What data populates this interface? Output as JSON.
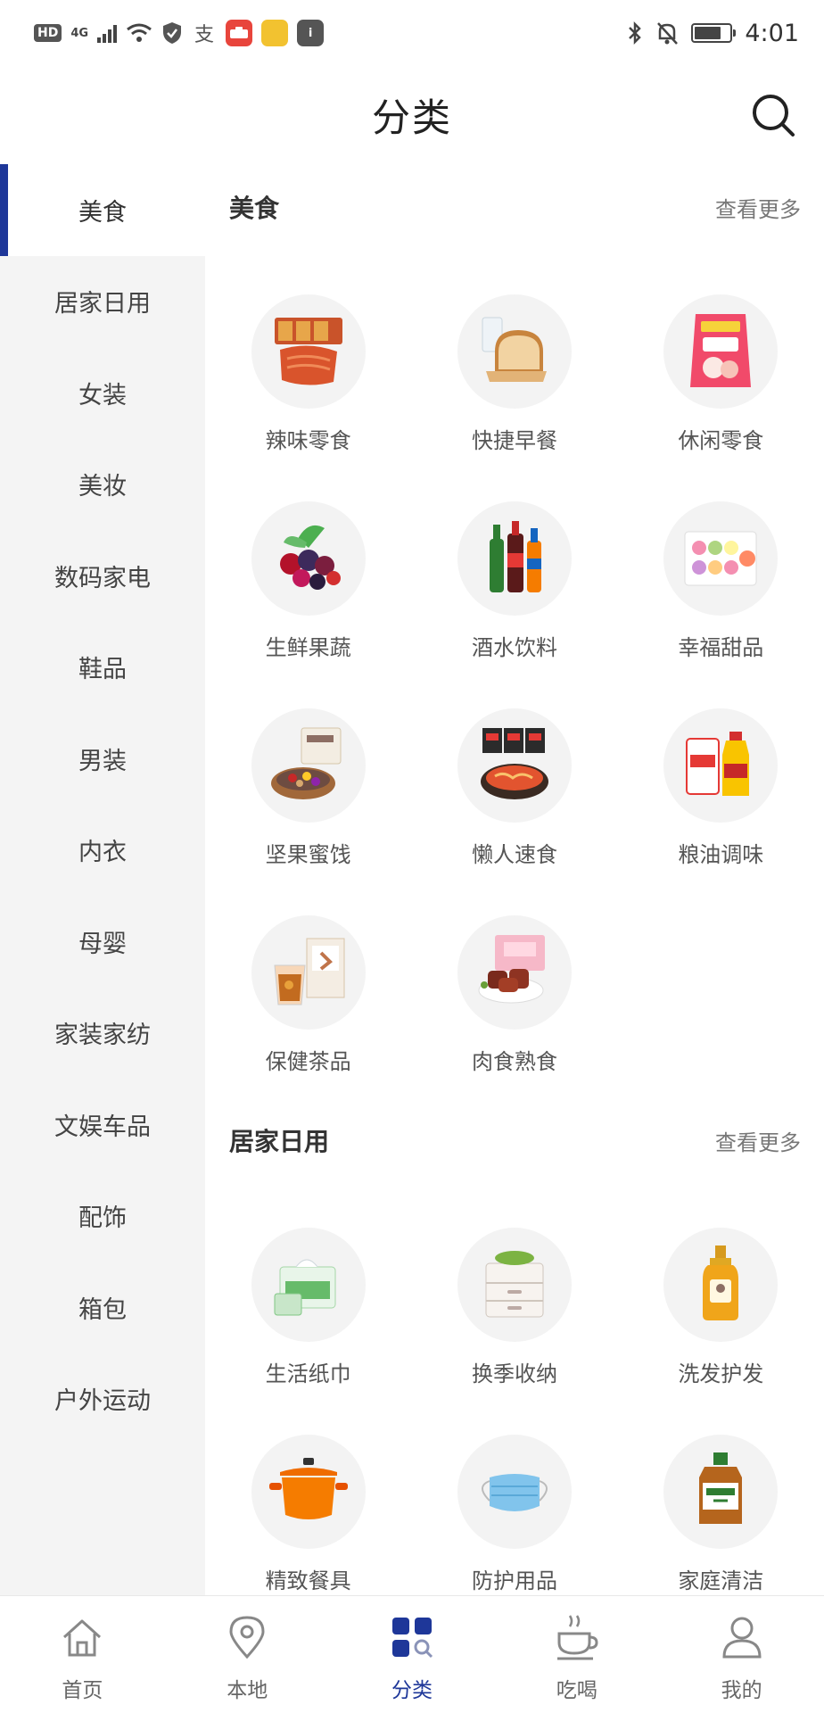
{
  "status_bar": {
    "hd": "HD",
    "network": "4G",
    "app_badge": "HUAWEI",
    "time": "4:01",
    "battery_level": 0.75
  },
  "header": {
    "title": "分类"
  },
  "sidebar": {
    "active_index": 0,
    "items": [
      {
        "label": "美食"
      },
      {
        "label": "居家日用"
      },
      {
        "label": "女装"
      },
      {
        "label": "美妆"
      },
      {
        "label": "数码家电"
      },
      {
        "label": "鞋品"
      },
      {
        "label": "男装"
      },
      {
        "label": "内衣"
      },
      {
        "label": "母婴"
      },
      {
        "label": "家装家纺"
      },
      {
        "label": "文娱车品"
      },
      {
        "label": "配饰"
      },
      {
        "label": "箱包"
      },
      {
        "label": "户外运动"
      }
    ]
  },
  "sections": [
    {
      "title": "美食",
      "more": "查看更多",
      "items": [
        {
          "label": "辣味零食",
          "icon": "spicy-snack-icon"
        },
        {
          "label": "快捷早餐",
          "icon": "bread-icon"
        },
        {
          "label": "休闲零食",
          "icon": "snack-bag-icon"
        },
        {
          "label": "生鲜果蔬",
          "icon": "berries-icon"
        },
        {
          "label": "酒水饮料",
          "icon": "bottles-icon"
        },
        {
          "label": "幸福甜品",
          "icon": "macaron-icon"
        },
        {
          "label": "坚果蜜饯",
          "icon": "nuts-icon"
        },
        {
          "label": "懒人速食",
          "icon": "instant-noodle-icon"
        },
        {
          "label": "粮油调味",
          "icon": "oil-rice-icon"
        },
        {
          "label": "保健茶品",
          "icon": "tea-icon"
        },
        {
          "label": "肉食熟食",
          "icon": "meat-icon"
        }
      ]
    },
    {
      "title": "居家日用",
      "more": "查看更多",
      "items": [
        {
          "label": "生活纸巾",
          "icon": "tissue-icon"
        },
        {
          "label": "换季收纳",
          "icon": "storage-box-icon"
        },
        {
          "label": "洗发护发",
          "icon": "shampoo-icon"
        },
        {
          "label": "精致餐具",
          "icon": "pot-icon"
        },
        {
          "label": "防护用品",
          "icon": "mask-icon"
        },
        {
          "label": "家庭清洁",
          "icon": "disinfectant-icon"
        }
      ]
    }
  ],
  "bottom_nav": {
    "active_index": 2,
    "items": [
      {
        "label": "首页",
        "icon": "home-icon"
      },
      {
        "label": "本地",
        "icon": "location-icon"
      },
      {
        "label": "分类",
        "icon": "category-icon"
      },
      {
        "label": "吃喝",
        "icon": "coffee-cup-icon"
      },
      {
        "label": "我的",
        "icon": "profile-icon"
      }
    ]
  },
  "colors": {
    "accent": "#1e3799",
    "sidebar_bg": "#f4f4f4",
    "thumb_bg": "#f3f3f3"
  }
}
